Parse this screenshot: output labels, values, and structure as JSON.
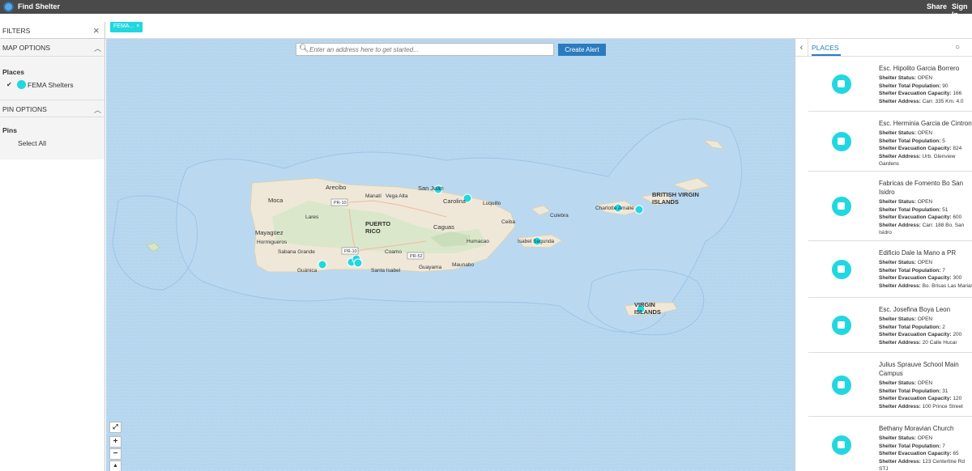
{
  "app": {
    "title": "Find Shelter",
    "share": "Share",
    "signin": "Sign In"
  },
  "chip": {
    "label": "FEMA...",
    "close": "×"
  },
  "filters": {
    "title": "FILTERS",
    "map_options": "MAP OPTIONS",
    "places_label": "Places",
    "places_item": "FEMA Shelters",
    "pin_options": "PIN OPTIONS",
    "pins_label": "Pins",
    "select_all": "Select All"
  },
  "search": {
    "placeholder": "Enter an address here to get started...",
    "button": "Create Alert"
  },
  "map_labels": {
    "arecibo": "Arecibo",
    "moca": "Moca",
    "manati": "Manatí",
    "vega_alta": "Vega Alta",
    "san_juan": "San Juan",
    "carolina": "Carolina",
    "luquillo": "Luquillo",
    "lares": "Lares",
    "puerto_rico": "PUERTO\nRICO",
    "caguas": "Caguas",
    "ceiba": "Ceiba",
    "culebra": "Culebra",
    "mayaguez": "Mayagüez",
    "hormigueros": "Hormigueros",
    "humacao": "Humacao",
    "sabana_grande": "Sabana Grande",
    "coamo": "Coamo",
    "guanica": "Guánica",
    "santa_isabel": "Santa Isabel",
    "guayama": "Guayama",
    "maunabo": "Maunabo",
    "isabel_segunda": "Isabel Segunda",
    "charlotte_amalie": "Charlotte Amalie",
    "bvi": "BRITISH VIRGIN\nISLANDS",
    "vi": "VIRGIN\nISLANDS",
    "pr10a": "PR-10",
    "pr10b": "PR-10",
    "pr52": "PR-52"
  },
  "map_controls": {
    "fullscreen": "⤢",
    "zoom_in": "+",
    "zoom_out": "−",
    "north": "▲"
  },
  "places": {
    "tab": "PLACES",
    "field_labels": {
      "status": "Shelter Status:",
      "population": "Shelter Total Population:",
      "capacity": "Shelter Evacuation Capacity:",
      "address": "Shelter Address:"
    },
    "items": [
      {
        "name": "Esc. Hipolito Garcia Borrero",
        "status": "OPEN",
        "population": "90",
        "capacity": "166",
        "address": "Carr. 335 Km. 4.0"
      },
      {
        "name": "Esc. Herminia Garcia de Cintron",
        "status": "OPEN",
        "population": "5",
        "capacity": "824",
        "address": "Urb. Glenview Gardens"
      },
      {
        "name": "Fabricas de Fomento Bo San Isidro",
        "status": "OPEN",
        "population": "51",
        "capacity": "600",
        "address": "Carr. 188 Bo. San Isidro"
      },
      {
        "name": "Edificio Dale la Mano a PR",
        "status": "OPEN",
        "population": "7",
        "capacity": "300",
        "address": "Bo. Brisas Las Marias"
      },
      {
        "name": "Esc. Josefina Boya Leon",
        "status": "OPEN",
        "population": "2",
        "capacity": "200",
        "address": "20 Calle Hucar"
      },
      {
        "name": "Julius Sprauve School Main Campus",
        "status": "OPEN",
        "population": "31",
        "capacity": "120",
        "address": "100 Prince Street"
      },
      {
        "name": "Bethany Moravian Church",
        "status": "OPEN",
        "population": "7",
        "capacity": "65",
        "address": "123 Centerline Rd STJ"
      }
    ]
  }
}
